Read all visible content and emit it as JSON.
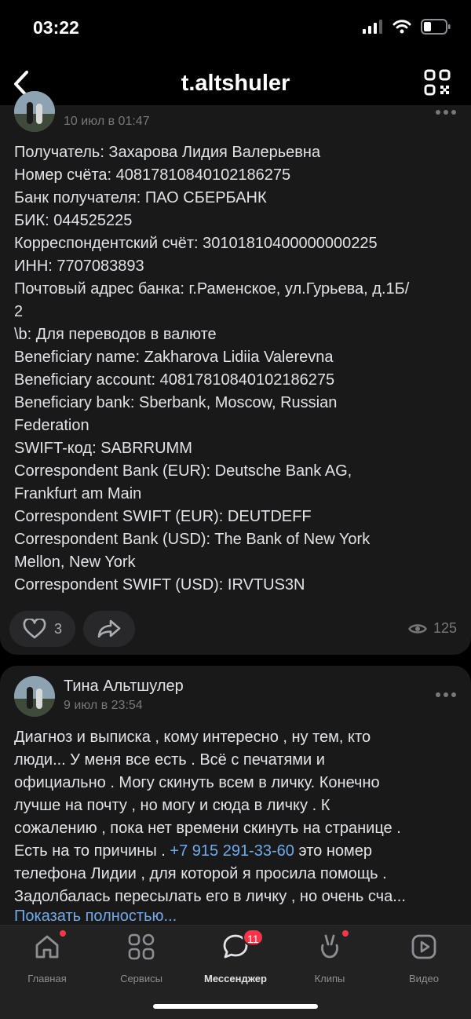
{
  "status_bar": {
    "time": "03:22"
  },
  "header": {
    "title": "t.altshuler"
  },
  "post1": {
    "date": "10 июл в 01:47",
    "lines": [
      "Получатель: Захарова Лидия Валерьевна",
      "Номер счёта: 40817810840102186275",
      "Банк получателя: ПАО СБЕРБАНК",
      "БИК: 044525225",
      "Корреспондентский счёт: 30101810400000000225",
      "ИНН: 7707083893",
      "Почтовый адрес банка: г.Раменское, ул.Гурьева, д.1Б/",
      "2",
      "\\b: Для переводов в валюте",
      "Beneficiary name: Zakharova Lidiia Valerevna",
      "Beneficiary account: 40817810840102186275",
      "Beneficiary bank: Sberbank, Moscow, Russian",
      "Federation",
      "SWIFT-код: SABRRUMM",
      "Correspondent Bank (EUR): Deutsche Bank AG,",
      "Frankfurt am Main",
      "Correspondent SWIFT (EUR): DEUTDEFF",
      "Correspondent Bank (USD): The Bank of New York",
      "Mellon, New York",
      "Correspondent SWIFT (USD): IRVTUS3N"
    ],
    "likes": "3",
    "views": "125"
  },
  "post2": {
    "author": "Тина Альтшулер",
    "date": "9 июл в 23:54",
    "lines": [
      "Диагноз и выписка , кому интересно , ну тем, кто",
      "люди... У меня все есть . Всё с печатями и",
      "официально . Могу скинуть всем в личку. Конечно",
      "лучше на почту , но могу и сюда в личку . К",
      "сожалению , пока нет времени скинуть на странице ."
    ],
    "line6_before": "Есть на то причины . ",
    "phone": "+7 915 291-33-60",
    "line6_after": " это номер",
    "line7": "телефона Лидии , для которой я просила помощь .",
    "line8": "Задолбалась пересылать его в личку , но очень сча...",
    "show_more": "Показать полностью..."
  },
  "tabbar": {
    "tabs": [
      {
        "label": "Главная",
        "icon": "home-icon"
      },
      {
        "label": "Сервисы",
        "icon": "services-icon"
      },
      {
        "label": "Мессенджер",
        "icon": "messenger-icon",
        "badge": "11"
      },
      {
        "label": "Клипы",
        "icon": "clips-icon"
      },
      {
        "label": "Видео",
        "icon": "video-icon"
      }
    ]
  },
  "colors": {
    "accent": "#71aaeb",
    "badge": "#ff3347",
    "card": "#19191a",
    "background": "#000000"
  }
}
